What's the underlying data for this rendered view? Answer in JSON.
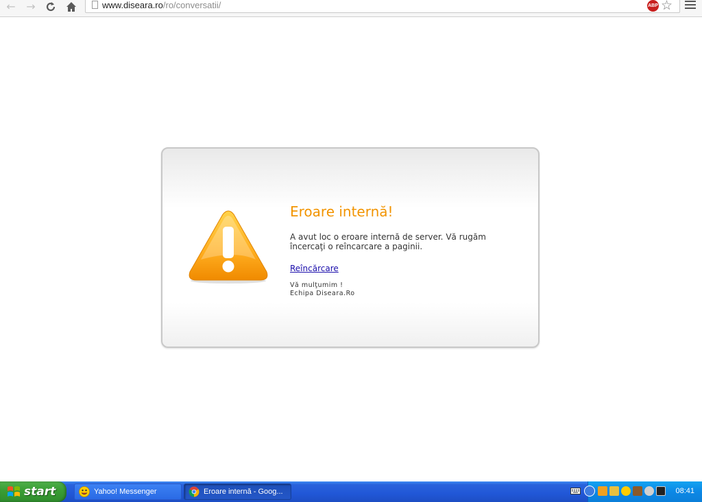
{
  "browser": {
    "url_host": "www.diseara.ro",
    "url_path": "/ro/conversatii/",
    "abp_label": "ABP"
  },
  "error": {
    "title": "Eroare internă!",
    "message": "A avut loc o eroare internă de server. Vă rugăm încercaţi o reîncarcare a paginii.",
    "reload_link": "Reîncărcare",
    "thanks": "Vă mulţumim !",
    "team": "Echipa Diseara.Ro"
  },
  "taskbar": {
    "start_label": "start",
    "tasks": [
      {
        "label": "Yahoo! Messenger",
        "active": false
      },
      {
        "label": "Eroare internă - Goog...",
        "active": true
      }
    ],
    "clock": "08:41"
  },
  "colors": {
    "title_orange": "#f29400",
    "link_blue": "#1a0dab",
    "taskbar_blue": "#2157d7",
    "start_green": "#3b9f36"
  }
}
